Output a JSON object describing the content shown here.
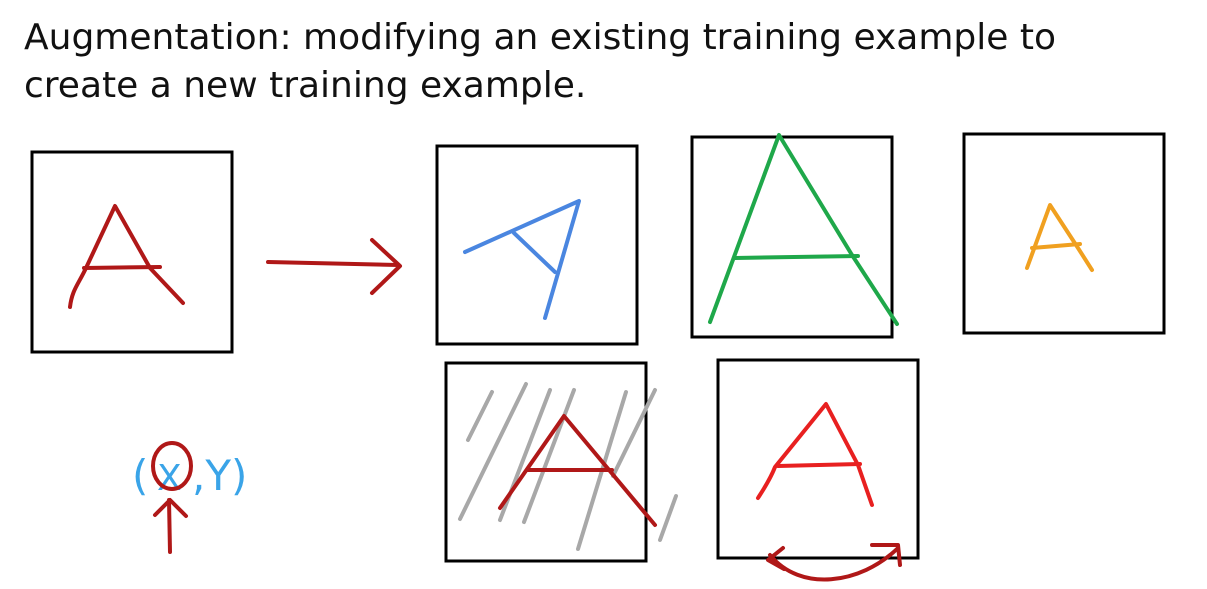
{
  "title": {
    "line1": "Augmentation: modifying an existing training example to",
    "line2": "create a new training example."
  },
  "annotation": {
    "open_paren": "(",
    "x": "X",
    "comma_y": ",Y)"
  },
  "colors": {
    "dark_red": "#b01818",
    "blue": "#4a86e0",
    "green": "#1fa84a",
    "orange": "#f0a020",
    "red": "#e82020",
    "gray": "#a8a8a8",
    "light_blue": "#3aa4e8",
    "box_border": "#000000",
    "text": "#111111"
  },
  "panels": [
    {
      "name": "original-letter-a",
      "color": "dark_red"
    },
    {
      "name": "rotated-letter-a",
      "color": "blue"
    },
    {
      "name": "enlarged-letter-a",
      "color": "green"
    },
    {
      "name": "shrunk-letter-a",
      "color": "orange"
    },
    {
      "name": "distorted-letter-a",
      "color": "dark_red"
    },
    {
      "name": "mirrored-letter-a",
      "color": "red"
    }
  ]
}
